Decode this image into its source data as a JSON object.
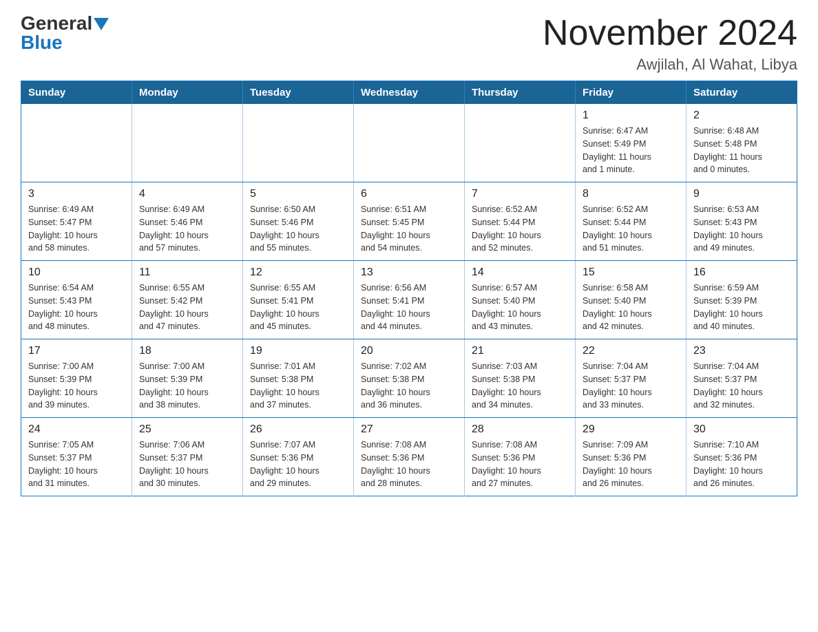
{
  "header": {
    "logo_general": "General",
    "logo_blue": "Blue",
    "month_year": "November 2024",
    "location": "Awjilah, Al Wahat, Libya"
  },
  "weekdays": [
    "Sunday",
    "Monday",
    "Tuesday",
    "Wednesday",
    "Thursday",
    "Friday",
    "Saturday"
  ],
  "weeks": [
    [
      {
        "day": "",
        "info": ""
      },
      {
        "day": "",
        "info": ""
      },
      {
        "day": "",
        "info": ""
      },
      {
        "day": "",
        "info": ""
      },
      {
        "day": "",
        "info": ""
      },
      {
        "day": "1",
        "info": "Sunrise: 6:47 AM\nSunset: 5:49 PM\nDaylight: 11 hours\nand 1 minute."
      },
      {
        "day": "2",
        "info": "Sunrise: 6:48 AM\nSunset: 5:48 PM\nDaylight: 11 hours\nand 0 minutes."
      }
    ],
    [
      {
        "day": "3",
        "info": "Sunrise: 6:49 AM\nSunset: 5:47 PM\nDaylight: 10 hours\nand 58 minutes."
      },
      {
        "day": "4",
        "info": "Sunrise: 6:49 AM\nSunset: 5:46 PM\nDaylight: 10 hours\nand 57 minutes."
      },
      {
        "day": "5",
        "info": "Sunrise: 6:50 AM\nSunset: 5:46 PM\nDaylight: 10 hours\nand 55 minutes."
      },
      {
        "day": "6",
        "info": "Sunrise: 6:51 AM\nSunset: 5:45 PM\nDaylight: 10 hours\nand 54 minutes."
      },
      {
        "day": "7",
        "info": "Sunrise: 6:52 AM\nSunset: 5:44 PM\nDaylight: 10 hours\nand 52 minutes."
      },
      {
        "day": "8",
        "info": "Sunrise: 6:52 AM\nSunset: 5:44 PM\nDaylight: 10 hours\nand 51 minutes."
      },
      {
        "day": "9",
        "info": "Sunrise: 6:53 AM\nSunset: 5:43 PM\nDaylight: 10 hours\nand 49 minutes."
      }
    ],
    [
      {
        "day": "10",
        "info": "Sunrise: 6:54 AM\nSunset: 5:43 PM\nDaylight: 10 hours\nand 48 minutes."
      },
      {
        "day": "11",
        "info": "Sunrise: 6:55 AM\nSunset: 5:42 PM\nDaylight: 10 hours\nand 47 minutes."
      },
      {
        "day": "12",
        "info": "Sunrise: 6:55 AM\nSunset: 5:41 PM\nDaylight: 10 hours\nand 45 minutes."
      },
      {
        "day": "13",
        "info": "Sunrise: 6:56 AM\nSunset: 5:41 PM\nDaylight: 10 hours\nand 44 minutes."
      },
      {
        "day": "14",
        "info": "Sunrise: 6:57 AM\nSunset: 5:40 PM\nDaylight: 10 hours\nand 43 minutes."
      },
      {
        "day": "15",
        "info": "Sunrise: 6:58 AM\nSunset: 5:40 PM\nDaylight: 10 hours\nand 42 minutes."
      },
      {
        "day": "16",
        "info": "Sunrise: 6:59 AM\nSunset: 5:39 PM\nDaylight: 10 hours\nand 40 minutes."
      }
    ],
    [
      {
        "day": "17",
        "info": "Sunrise: 7:00 AM\nSunset: 5:39 PM\nDaylight: 10 hours\nand 39 minutes."
      },
      {
        "day": "18",
        "info": "Sunrise: 7:00 AM\nSunset: 5:39 PM\nDaylight: 10 hours\nand 38 minutes."
      },
      {
        "day": "19",
        "info": "Sunrise: 7:01 AM\nSunset: 5:38 PM\nDaylight: 10 hours\nand 37 minutes."
      },
      {
        "day": "20",
        "info": "Sunrise: 7:02 AM\nSunset: 5:38 PM\nDaylight: 10 hours\nand 36 minutes."
      },
      {
        "day": "21",
        "info": "Sunrise: 7:03 AM\nSunset: 5:38 PM\nDaylight: 10 hours\nand 34 minutes."
      },
      {
        "day": "22",
        "info": "Sunrise: 7:04 AM\nSunset: 5:37 PM\nDaylight: 10 hours\nand 33 minutes."
      },
      {
        "day": "23",
        "info": "Sunrise: 7:04 AM\nSunset: 5:37 PM\nDaylight: 10 hours\nand 32 minutes."
      }
    ],
    [
      {
        "day": "24",
        "info": "Sunrise: 7:05 AM\nSunset: 5:37 PM\nDaylight: 10 hours\nand 31 minutes."
      },
      {
        "day": "25",
        "info": "Sunrise: 7:06 AM\nSunset: 5:37 PM\nDaylight: 10 hours\nand 30 minutes."
      },
      {
        "day": "26",
        "info": "Sunrise: 7:07 AM\nSunset: 5:36 PM\nDaylight: 10 hours\nand 29 minutes."
      },
      {
        "day": "27",
        "info": "Sunrise: 7:08 AM\nSunset: 5:36 PM\nDaylight: 10 hours\nand 28 minutes."
      },
      {
        "day": "28",
        "info": "Sunrise: 7:08 AM\nSunset: 5:36 PM\nDaylight: 10 hours\nand 27 minutes."
      },
      {
        "day": "29",
        "info": "Sunrise: 7:09 AM\nSunset: 5:36 PM\nDaylight: 10 hours\nand 26 minutes."
      },
      {
        "day": "30",
        "info": "Sunrise: 7:10 AM\nSunset: 5:36 PM\nDaylight: 10 hours\nand 26 minutes."
      }
    ]
  ]
}
